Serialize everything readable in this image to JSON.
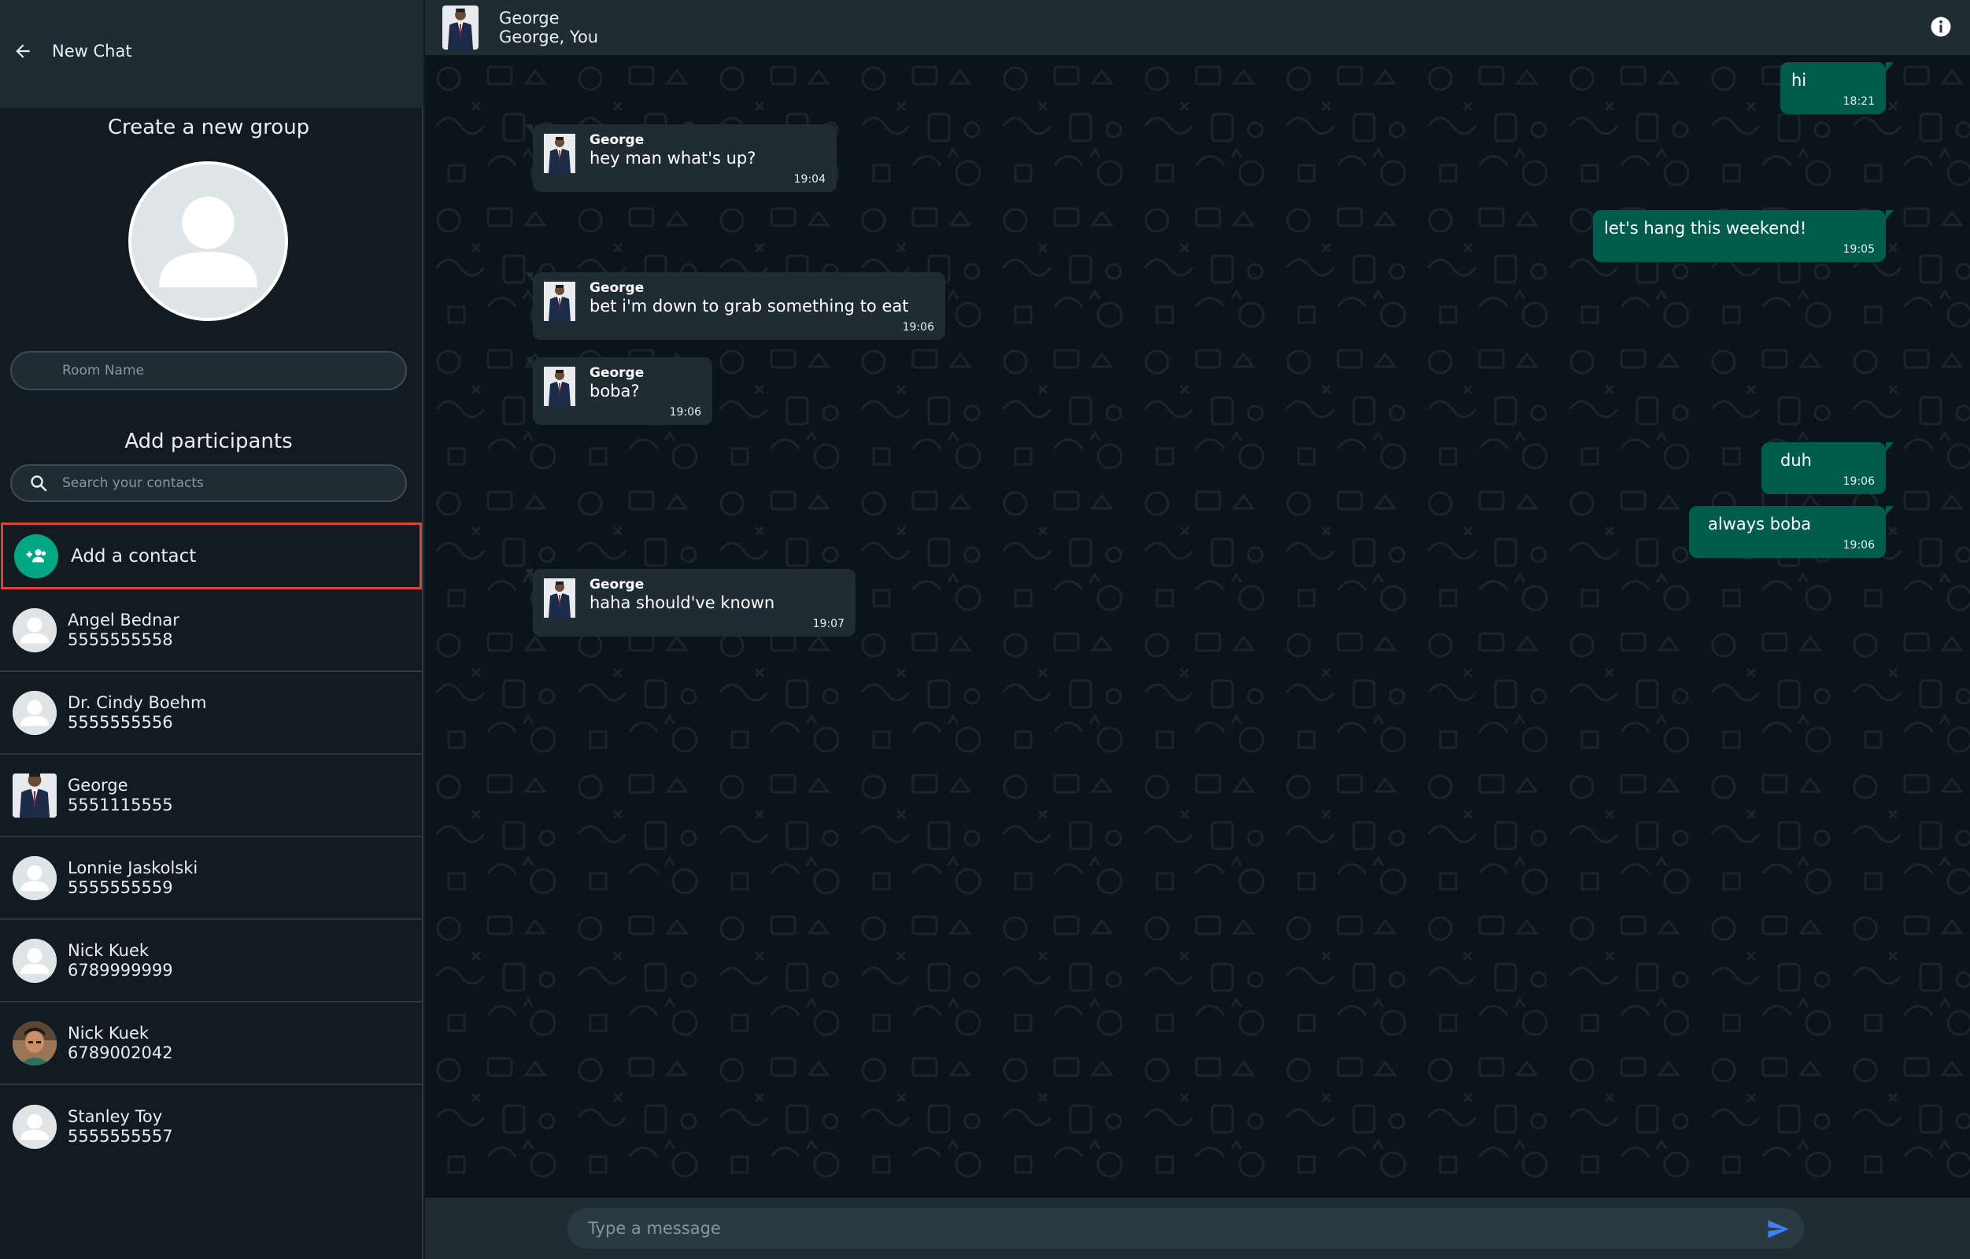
{
  "sidebar": {
    "header_title": "New Chat",
    "create_group_title": "Create a new group",
    "room_name_placeholder": "Room Name",
    "add_participants_title": "Add participants",
    "search_placeholder": "Search your contacts",
    "add_contact_label": "Add a contact",
    "contacts": [
      {
        "name": "Angel Bednar",
        "phone": "5555555558",
        "avatar": "default"
      },
      {
        "name": "Dr. Cindy Boehm",
        "phone": "5555555556",
        "avatar": "default"
      },
      {
        "name": "George",
        "phone": "5551115555",
        "avatar": "photo-suit"
      },
      {
        "name": "Lonnie Jaskolski",
        "phone": "5555555559",
        "avatar": "default"
      },
      {
        "name": "Nick Kuek",
        "phone": "6789999999",
        "avatar": "default"
      },
      {
        "name": "Nick Kuek",
        "phone": "6789002042",
        "avatar": "photo-face"
      },
      {
        "name": "Stanley Toy",
        "phone": "5555555557",
        "avatar": "default"
      }
    ]
  },
  "chat": {
    "header_name": "George",
    "header_members": "George, You",
    "message_placeholder": "Type a message",
    "messages": [
      {
        "direction": "out",
        "text": "hi",
        "time": "18:21"
      },
      {
        "direction": "in",
        "sender": "George",
        "text": "hey man what's up?",
        "time": "19:04"
      },
      {
        "direction": "out",
        "text": "let's hang this weekend!",
        "time": "19:05"
      },
      {
        "direction": "in",
        "sender": "George",
        "text": "bet i'm down to grab something to eat",
        "time": "19:06"
      },
      {
        "direction": "in",
        "sender": "George",
        "text": "boba?",
        "time": "19:06"
      },
      {
        "direction": "out",
        "text": "duh",
        "time": "19:06"
      },
      {
        "direction": "out",
        "text": "always boba",
        "time": "19:06"
      },
      {
        "direction": "in",
        "sender": "George",
        "text": "haha should've known",
        "time": "19:07"
      }
    ]
  },
  "colors": {
    "accent": "#00a884",
    "outgoing_bubble": "#005c4b",
    "incoming_bubble": "#202c33",
    "highlight_border": "#e0403a",
    "send_icon": "#3b82f6"
  },
  "icons": {
    "back": "arrow-left-icon",
    "search": "search-icon",
    "add_contact": "group-add-icon",
    "info": "info-icon",
    "send": "send-icon",
    "default_avatar": "person-icon"
  }
}
